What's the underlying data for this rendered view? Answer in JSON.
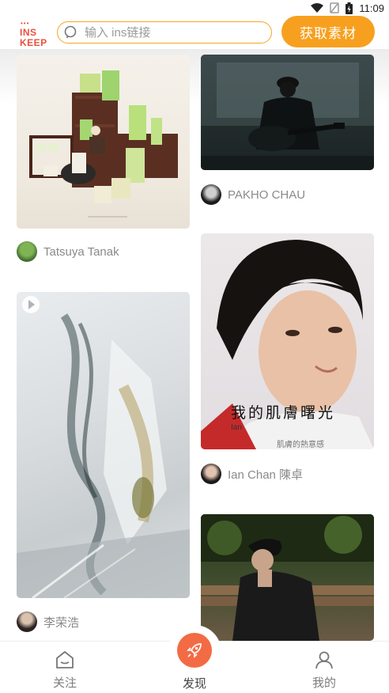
{
  "status_bar": {
    "time": "11:09"
  },
  "header": {
    "logo_dots": "•••",
    "logo_line1": "INS",
    "logo_line2": "KEEP",
    "search_placeholder": "输入 ins链接",
    "get_button": "获取素材"
  },
  "feed": {
    "left": [
      {
        "author": "Tatsuya Tanak",
        "image": "matcha-miniature"
      },
      {
        "author": "李荣浩",
        "image": "plastic-bag-macro"
      }
    ],
    "right": [
      {
        "author": "PAKHO CHAU",
        "image": "guitar-silhouette"
      },
      {
        "author": "Ian Chan 陳卓",
        "image": "portrait-album-cover",
        "overlay_title": "我的肌膚曙光",
        "overlay_name": "Ian",
        "overlay_subtitle": "肌膚的熱意感"
      },
      {
        "author": "",
        "image": "bench-portrait"
      }
    ]
  },
  "bottom_nav": {
    "items": [
      {
        "label": "关注",
        "icon": "home-icon"
      },
      {
        "label": "发现",
        "icon": "rocket-icon"
      },
      {
        "label": "我的",
        "icon": "person-icon"
      }
    ]
  },
  "colors": {
    "accent": "#f7a01f",
    "rocket": "#f36b45",
    "logo": "#e8503a"
  }
}
